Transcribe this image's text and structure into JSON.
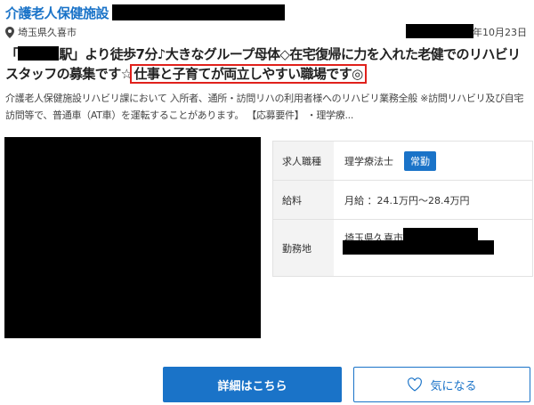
{
  "facility": {
    "title": "介護老人保健施設"
  },
  "location": {
    "text": "埼玉県久喜市"
  },
  "date": {
    "text": "年10月23日"
  },
  "headline": {
    "open": "「",
    "main": "駅」より徒歩7分♪大きなグループ母体◇在宅復帰に力を入れた老健でのリハビリスタッフの募集です☆",
    "highlight": "仕事と子育てが両立しやすい職場です◎"
  },
  "description": "介護老人保健施設リハビリ課において 入所者、通所・訪問リハの利用者様へのリハビリ業務全般 ※訪問リハビリ及び自宅訪問等で、普通車（AT車）を運転することがあります。 【応募要件】 ・理学療...",
  "info": {
    "job_type": {
      "label": "求人職種",
      "value": "理学療法士",
      "badge": "常勤"
    },
    "salary": {
      "label": "給料",
      "value": "月給 ：24.1万円〜28.4万円"
    },
    "workplace": {
      "label": "勤務地",
      "value": "埼玉県久喜市"
    }
  },
  "buttons": {
    "detail": "詳細はこちら",
    "favorite": "気になる"
  },
  "colors": {
    "accent": "#1a73c8",
    "highlight_border": "#e0201b"
  }
}
